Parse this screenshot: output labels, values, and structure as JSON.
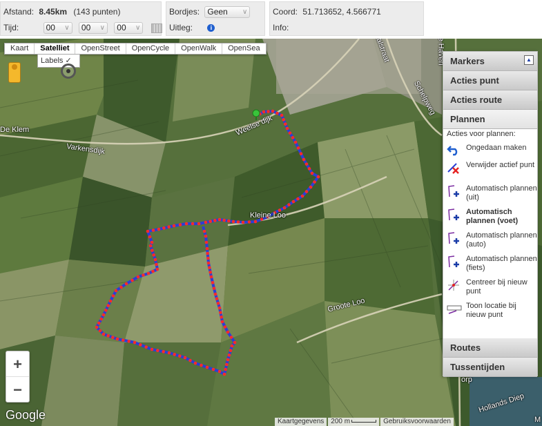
{
  "topbar": {
    "distance_label": "Afstand:",
    "distance_value": "8.45km",
    "distance_points": "(143 punten)",
    "time_label": "Tijd:",
    "time_hours": "00",
    "time_minutes": "00",
    "time_seconds": "00",
    "signs_label": "Bordjes:",
    "signs_value": "Geen",
    "explain_label": "Uitleg:",
    "explain_icon": "info-icon",
    "coord_label": "Coord:",
    "coord_value": "51.713652, 4.566771",
    "info_label": "Info:",
    "info_value": ""
  },
  "map": {
    "map_types": [
      "Kaart",
      "Satelliet",
      "OpenStreet",
      "OpenCycle",
      "OpenWalk",
      "OpenSea"
    ],
    "active_map_type": "Satelliet",
    "labels_option": "Labels",
    "place_labels": {
      "de_klem": "De Klem",
      "varkensdijk": "Varkensdijk",
      "weelse_dijk": "Weelse dijk",
      "kleine_loo": "Kleine Loo",
      "groote_loo": "Groote Loo",
      "hollands_diep": "Hollands Diep",
      "schelpweg": "Schelpweg",
      "kanaalstraat": "anaalstraat",
      "oude_haven": "ude Haven",
      "orp": "orp",
      "moerdijk_cut": "M"
    },
    "zoom_in": "+",
    "zoom_out": "−",
    "google_logo": "Google",
    "attribution": {
      "map_data": "Kaartgegevens",
      "scale": "200 m",
      "terms": "Gebruiksvoorwaarden"
    }
  },
  "side_panel": {
    "sections_top": [
      "Markers",
      "Acties punt",
      "Acties route",
      "Plannen"
    ],
    "sections_bottom": [
      "Routes",
      "Tussentijden"
    ],
    "open_section": "Plannen",
    "plan_subtitle": "Acties voor plannen:",
    "actions": [
      {
        "label": "Ongedaan maken",
        "icon": "undo-icon",
        "bold": false
      },
      {
        "label": "Verwijder actief punt",
        "icon": "delete-point-icon",
        "bold": false
      },
      {
        "label": "Automatisch plannen (uit)",
        "icon": "autoplan-off-icon",
        "bold": false
      },
      {
        "label": "Automatisch plannen (voet)",
        "icon": "autoplan-walk-icon",
        "bold": true
      },
      {
        "label": "Automatisch plannen (auto)",
        "icon": "autoplan-car-icon",
        "bold": false
      },
      {
        "label": "Automatisch plannen (fiets)",
        "icon": "autoplan-bike-icon",
        "bold": false
      },
      {
        "label": "Centreer bij nieuw punt",
        "icon": "center-icon",
        "bold": false
      },
      {
        "label": "Toon locatie bij nieuw punt",
        "icon": "show-location-icon",
        "bold": false
      }
    ]
  },
  "colors": {
    "route_line": "#2a3fd6",
    "route_point": "#ff2a2a",
    "start_marker": "#39c43a"
  }
}
